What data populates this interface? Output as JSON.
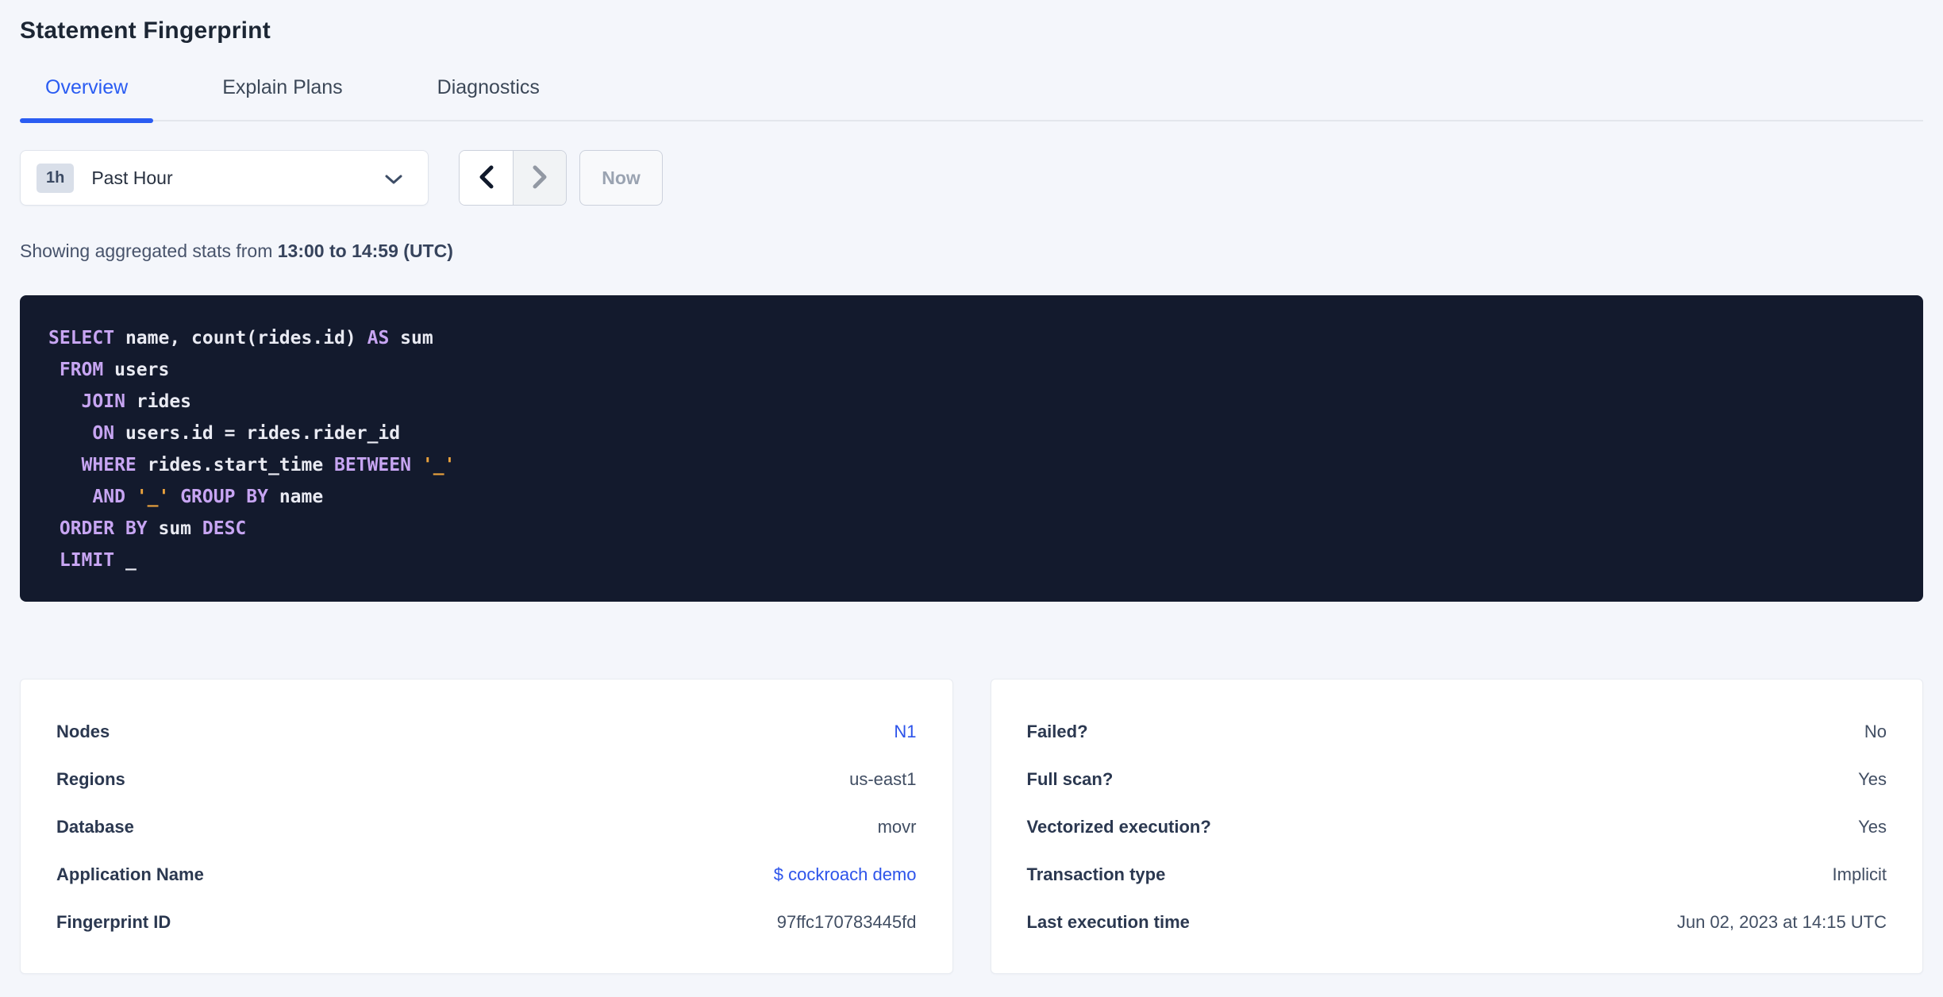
{
  "page": {
    "title": "Statement Fingerprint"
  },
  "tabs": [
    {
      "label": "Overview",
      "active": true
    },
    {
      "label": "Explain Plans",
      "active": false
    },
    {
      "label": "Diagnostics",
      "active": false
    }
  ],
  "time_controls": {
    "badge": "1h",
    "selected": "Past Hour",
    "now_label": "Now",
    "dropdown_icon": "chevron-down-icon",
    "prev_icon": "chevron-left-icon",
    "next_icon": "chevron-right-icon",
    "prev_enabled": true,
    "next_enabled": false
  },
  "stats_line": {
    "prefix": "Showing aggregated stats from ",
    "range_bold": "13:00 to 14:59 (UTC)"
  },
  "sql": {
    "lines": [
      [
        {
          "t": "k",
          "v": "SELECT"
        },
        {
          "t": "p",
          "v": " name, count(rides.id) "
        },
        {
          "t": "k",
          "v": "AS"
        },
        {
          "t": "p",
          "v": " sum"
        }
      ],
      [
        {
          "t": "p",
          "v": " "
        },
        {
          "t": "k",
          "v": "FROM"
        },
        {
          "t": "p",
          "v": " users"
        }
      ],
      [
        {
          "t": "p",
          "v": "   "
        },
        {
          "t": "k",
          "v": "JOIN"
        },
        {
          "t": "p",
          "v": " rides"
        }
      ],
      [
        {
          "t": "p",
          "v": "    "
        },
        {
          "t": "k",
          "v": "ON"
        },
        {
          "t": "p",
          "v": " users.id = rides.rider_id"
        }
      ],
      [
        {
          "t": "p",
          "v": "   "
        },
        {
          "t": "k",
          "v": "WHERE"
        },
        {
          "t": "p",
          "v": " rides.start_time "
        },
        {
          "t": "k",
          "v": "BETWEEN"
        },
        {
          "t": "p",
          "v": " "
        },
        {
          "t": "s",
          "v": "'_'"
        }
      ],
      [
        {
          "t": "p",
          "v": "    "
        },
        {
          "t": "k",
          "v": "AND"
        },
        {
          "t": "p",
          "v": " "
        },
        {
          "t": "s",
          "v": "'_'"
        },
        {
          "t": "p",
          "v": " "
        },
        {
          "t": "k",
          "v": "GROUP BY"
        },
        {
          "t": "p",
          "v": " name"
        }
      ],
      [
        {
          "t": "p",
          "v": " "
        },
        {
          "t": "k",
          "v": "ORDER BY"
        },
        {
          "t": "p",
          "v": " sum "
        },
        {
          "t": "k",
          "v": "DESC"
        }
      ],
      [
        {
          "t": "p",
          "v": " "
        },
        {
          "t": "k",
          "v": "LIMIT"
        },
        {
          "t": "p",
          "v": " _"
        }
      ]
    ]
  },
  "cards": {
    "left": {
      "rows": [
        {
          "label": "Nodes",
          "value": "N1",
          "link": true
        },
        {
          "label": "Regions",
          "value": "us-east1",
          "link": false
        },
        {
          "label": "Database",
          "value": "movr",
          "link": false
        },
        {
          "label": "Application Name",
          "value": "$ cockroach demo",
          "link": true
        },
        {
          "label": "Fingerprint ID",
          "value": "97ffc170783445fd",
          "link": false
        }
      ]
    },
    "right": {
      "rows": [
        {
          "label": "Failed?",
          "value": "No"
        },
        {
          "label": "Full scan?",
          "value": "Yes"
        },
        {
          "label": "Vectorized execution?",
          "value": "Yes"
        },
        {
          "label": "Transaction type",
          "value": "Implicit"
        },
        {
          "label": "Last execution time",
          "value": "Jun 02, 2023 at 14:15 UTC"
        }
      ]
    }
  },
  "colors": {
    "page_bg": "#f4f6fb",
    "accent_blue": "#2a5cf2",
    "link_blue": "#2c53ea",
    "sql_bg": "#131a2d",
    "sql_keyword": "#c7a5f2",
    "sql_plain": "#e9eaf2",
    "sql_string": "#e9a13d",
    "badge_bg": "#d9dfe9"
  }
}
